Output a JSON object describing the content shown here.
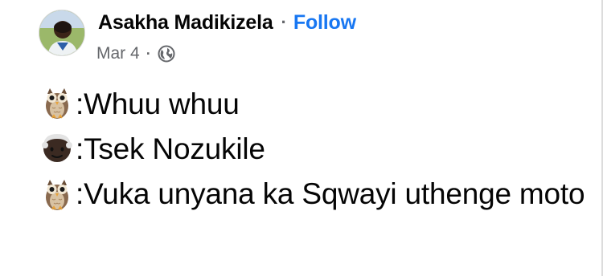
{
  "post": {
    "author": "Asakha Madikizela",
    "separator": "·",
    "follow_label": "Follow",
    "date": "Mar 4",
    "meta_separator": "·",
    "audience_icon": "globe-icon",
    "lines": [
      {
        "emoji": "owl-emoji",
        "text": ":Whuu whuu"
      },
      {
        "emoji": "older-person-emoji",
        "text": ":Tsek Nozukile"
      },
      {
        "emoji": "owl-emoji",
        "text": ":Vuka unyana ka Sqwayi uthenge moto"
      }
    ]
  },
  "colors": {
    "follow": "#1877f2",
    "meta": "#65676b",
    "text": "#050505"
  }
}
